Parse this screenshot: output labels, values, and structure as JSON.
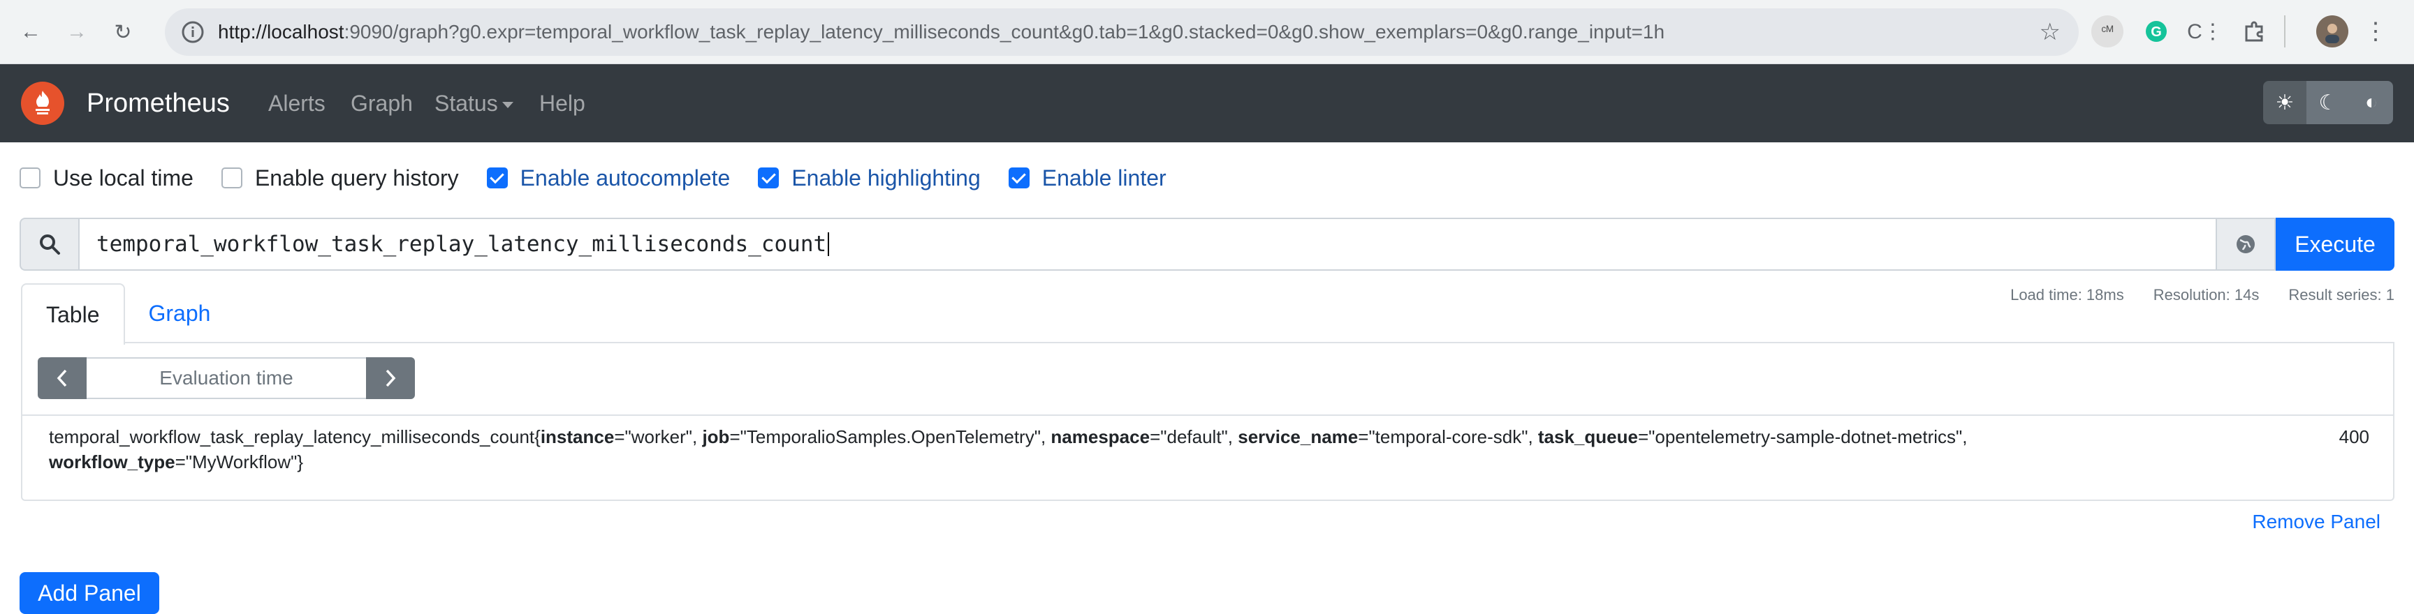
{
  "browser": {
    "url_host": "http://localhost",
    "url_rest": ":9090/graph?g0.expr=temporal_workflow_task_replay_latency_milliseconds_count&g0.tab=1&g0.stacked=0&g0.show_exemplars=0&g0.range_input=1h",
    "back_icon": "←",
    "forward_icon": "→",
    "reload_icon": "↻",
    "star_icon": "☆"
  },
  "navbar": {
    "brand": "Prometheus",
    "links": [
      "Alerts",
      "Graph",
      "Status",
      "Help"
    ],
    "theme_icons": [
      "☀",
      "☾",
      "◐"
    ]
  },
  "options": {
    "use_local_time": {
      "label": "Use local time",
      "checked": false
    },
    "query_history": {
      "label": "Enable query history",
      "checked": false
    },
    "autocomplete": {
      "label": "Enable autocomplete",
      "checked": true
    },
    "highlighting": {
      "label": "Enable highlighting",
      "checked": true
    },
    "linter": {
      "label": "Enable linter",
      "checked": true
    }
  },
  "query": {
    "expression": "temporal_workflow_task_replay_latency_milliseconds_count",
    "execute_label": "Execute"
  },
  "stats": {
    "load_time": "Load time: 18ms",
    "resolution": "Resolution: 14s",
    "result_series": "Result series: 1"
  },
  "tabs": [
    "Table",
    "Graph"
  ],
  "panel": {
    "eval_placeholder": "Evaluation time",
    "result": {
      "metric": "temporal_workflow_task_replay_latency_milliseconds_count",
      "labels": [
        {
          "k": "instance",
          "v": "\"worker\""
        },
        {
          "k": "job",
          "v": "\"TemporalioSamples.OpenTelemetry\""
        },
        {
          "k": "namespace",
          "v": "\"default\""
        },
        {
          "k": "service_name",
          "v": "\"temporal-core-sdk\""
        },
        {
          "k": "task_queue",
          "v": "\"opentelemetry-sample-dotnet-metrics\""
        },
        {
          "k": "workflow_type",
          "v": "\"MyWorkflow\""
        }
      ],
      "value": "400"
    },
    "remove_label": "Remove Panel"
  },
  "add_panel_label": "Add Panel"
}
